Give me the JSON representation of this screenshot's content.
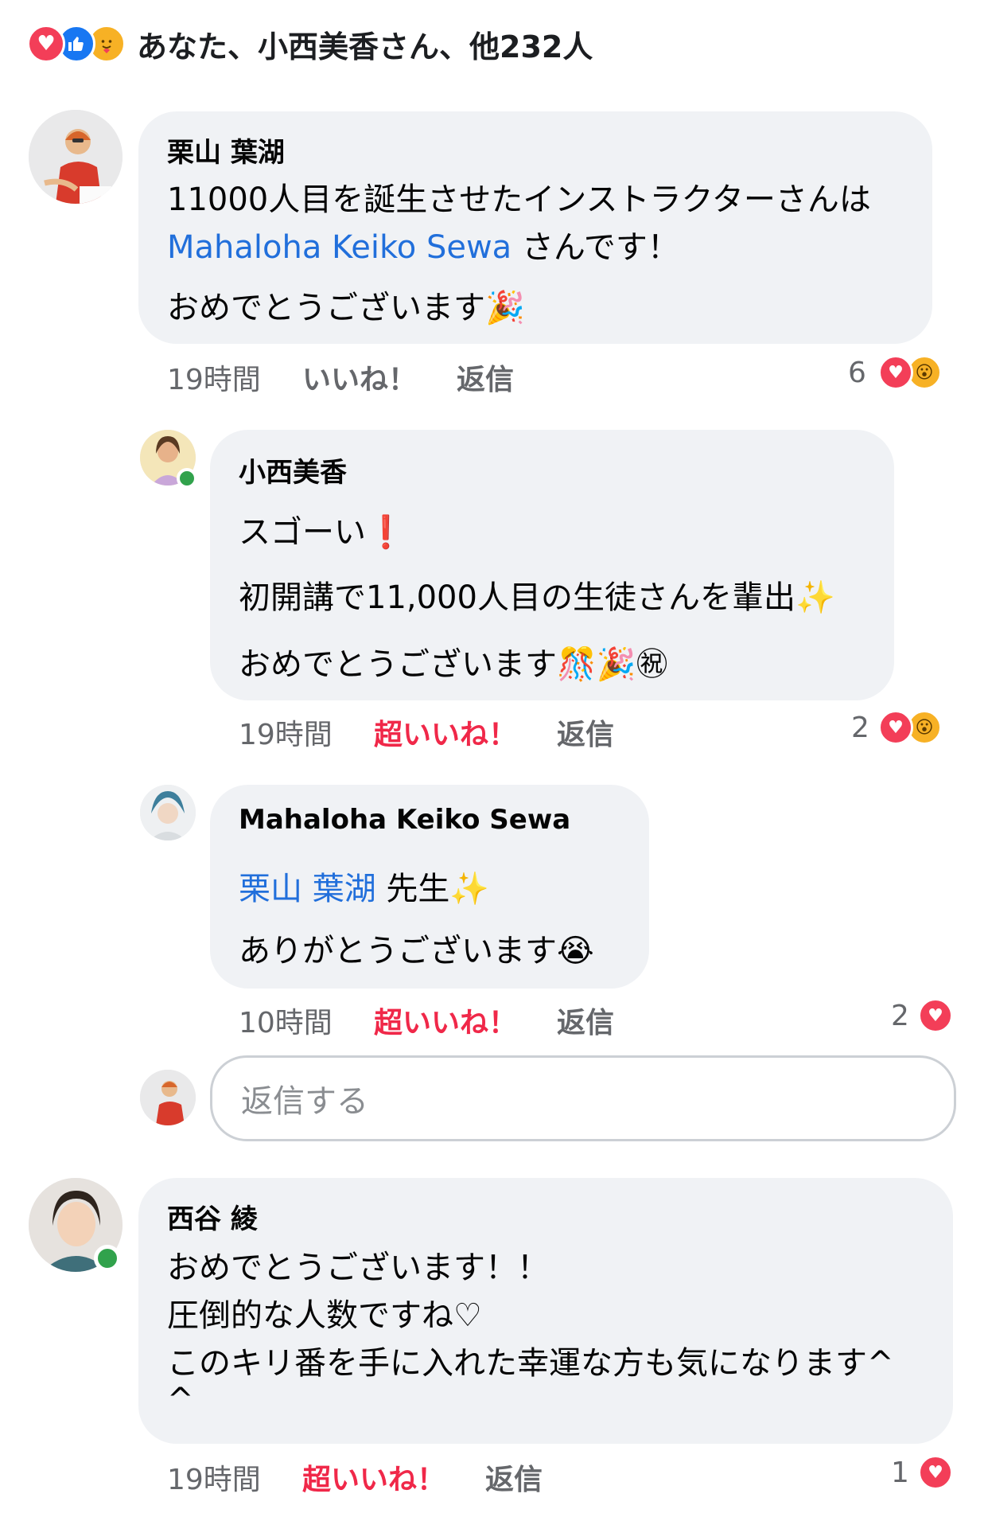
{
  "summary": {
    "text": "あなた、小西美香さん、他232人",
    "icons": [
      "love-icon",
      "like-icon",
      "care-icon"
    ]
  },
  "comments": [
    {
      "author": "栗山 葉湖",
      "line1": "11000人目を誕生させたインストラクターさんは",
      "line2_mention": "Mahaloha Keiko Sewa",
      "line2_rest": " さんです！",
      "line3": "おめでとうございます🎉",
      "time": "19時間",
      "like": "いいね！",
      "reply": "返信",
      "count": "6"
    },
    {
      "author": "小西美香",
      "line1": "スゴーい❗",
      "line2": "初開講で11,000人目の生徒さんを輩出✨",
      "line3": "おめでとうございます🎊🎉㊗",
      "time": "19時間",
      "like": "超いいね！",
      "reply": "返信",
      "count": "2"
    },
    {
      "author": "Mahaloha Keiko Sewa",
      "line1_mention": "栗山 葉湖",
      "line1_rest": " 先生✨",
      "line2": "ありがとうございます😭",
      "time": "10時間",
      "like": "超いいね！",
      "reply": "返信",
      "count": "2"
    },
    {
      "author": "西谷 綾",
      "line1": "おめでとうございます！！",
      "line2": "圧倒的な人数ですね♡",
      "line3": "このキリ番を手に入れた幸運な方も気になります^",
      "line4": "^",
      "time": "19時間",
      "like": "超いいね！",
      "reply": "返信",
      "count": "1"
    }
  ],
  "reply_box": {
    "placeholder": "返信する"
  },
  "colors": {
    "bubble": "#f0f2f5",
    "mention": "#216fdb",
    "love": "#f02849",
    "meta": "#65676b",
    "online": "#31a24c"
  }
}
